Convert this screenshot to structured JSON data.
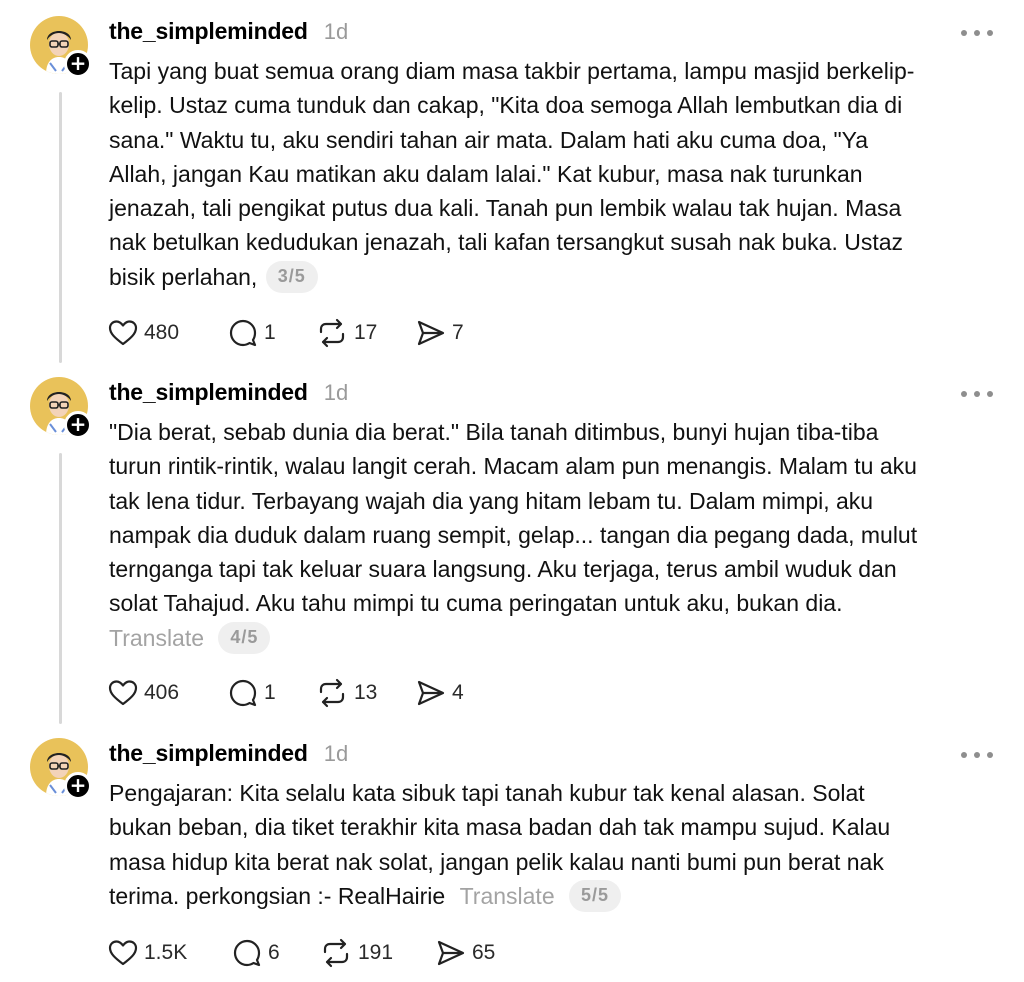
{
  "posts": [
    {
      "username": "the_simpleminded",
      "time": "1d",
      "lines": [
        "Tapi yang buat semua orang diam masa takbir pertama, lampu masjid berkelip-",
        "kelip. Ustaz cuma tunduk dan cakap, \"Kita doa semoga Allah lembutkan dia di",
        "sana.\" Waktu tu, aku sendiri tahan air mata. Dalam hati aku cuma doa, \"Ya",
        "Allah, jangan Kau matikan aku dalam lalai.\" Kat kubur, masa nak turunkan",
        "jenazah, tali pengikat putus dua kali. Tanah pun lembik walau tak hujan. Masa",
        "nak betulkan kedudukan jenazah, tali kafan tersangkut susah nak buka. Ustaz",
        "bisik perlahan,"
      ],
      "translate": "",
      "pager": "3/5",
      "likes": "480",
      "replies": "1",
      "reposts": "17",
      "shares": "7"
    },
    {
      "username": "the_simpleminded",
      "time": "1d",
      "lines": [
        "\"Dia berat, sebab dunia dia berat.\" Bila tanah ditimbus, bunyi hujan tiba-tiba",
        "turun rintik-rintik, walau langit cerah. Macam alam pun menangis. Malam tu aku",
        "tak lena tidur. Terbayang wajah dia yang hitam lebam tu. Dalam mimpi, aku",
        "nampak dia duduk dalam ruang sempit, gelap... tangan dia pegang dada, mulut",
        "ternganga tapi tak keluar suara langsung. Aku terjaga, terus ambil wuduk dan",
        "solat Tahajud. Aku tahu mimpi tu cuma peringatan untuk aku, bukan dia.",
        ""
      ],
      "translate": "Translate",
      "pager": "4/5",
      "likes": "406",
      "replies": "1",
      "reposts": "13",
      "shares": "4"
    },
    {
      "username": "the_simpleminded",
      "time": "1d",
      "lines": [
        "Pengajaran: Kita selalu kata sibuk tapi tanah kubur tak kenal alasan. Solat",
        "bukan beban, dia tiket terakhir kita masa badan dah tak mampu sujud. Kalau",
        "masa hidup kita berat nak solat, jangan pelik kalau nanti bumi pun berat nak",
        "terima. perkongsian :- RealHairie"
      ],
      "translate": "Translate",
      "pager": "5/5",
      "likes": "1.5K",
      "replies": "6",
      "reposts": "191",
      "shares": "65"
    }
  ],
  "icons": {
    "avatar": "avatar-illustration",
    "follow": "plus-icon",
    "more": "more-icon",
    "like": "heart-icon",
    "reply": "reply-icon",
    "repost": "repost-icon",
    "share": "share-icon"
  },
  "badge_symbol": "+"
}
